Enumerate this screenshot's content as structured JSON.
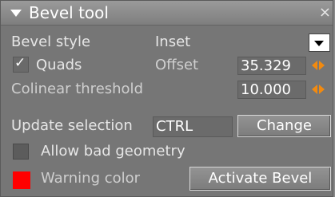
{
  "title": "Bevel tool",
  "close_glyph": "×",
  "bevel_style": {
    "label": "Bevel style",
    "value": "Inset"
  },
  "quads": {
    "label": "Quads",
    "checked": true,
    "check_glyph": "✓"
  },
  "offset": {
    "label": "Offset",
    "value": "35.329"
  },
  "colinear_threshold": {
    "label": "Colinear threshold",
    "value": "10.000"
  },
  "update_selection": {
    "label": "Update selection",
    "key": "CTRL",
    "button": "Change"
  },
  "allow_bad_geometry": {
    "label": "Allow bad geometry",
    "checked": false
  },
  "warning_color": {
    "label": "Warning color",
    "color": "#ff0000"
  },
  "activate_button": "Activate Bevel",
  "colors": {
    "panel_bg": "#767676",
    "spinner_accent": "#f28a0f"
  }
}
